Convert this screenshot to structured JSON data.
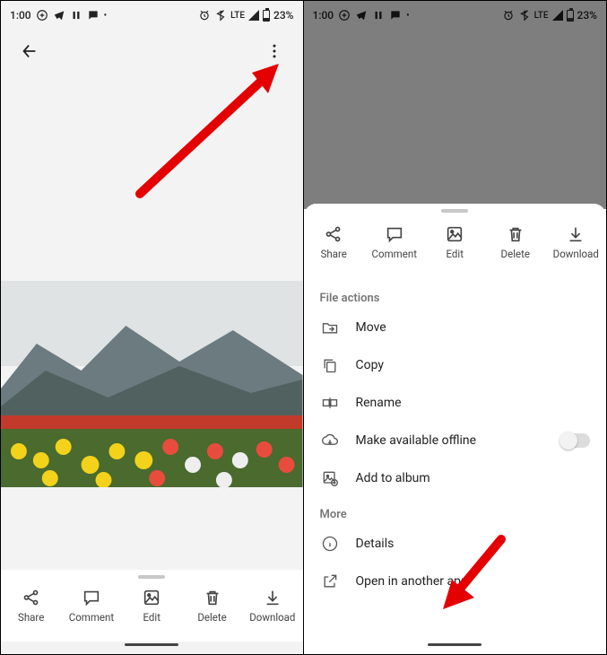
{
  "status": {
    "time": "1:00",
    "lte": "LTE",
    "battery": "23%"
  },
  "actions": {
    "share": "Share",
    "comment": "Comment",
    "edit": "Edit",
    "delete": "Delete",
    "download": "Download"
  },
  "sheet": {
    "section_file_actions": "File actions",
    "section_more": "More",
    "move": "Move",
    "copy": "Copy",
    "rename": "Rename",
    "offline": "Make available offline",
    "add_album": "Add to album",
    "details": "Details",
    "open_other": "Open in another app"
  }
}
